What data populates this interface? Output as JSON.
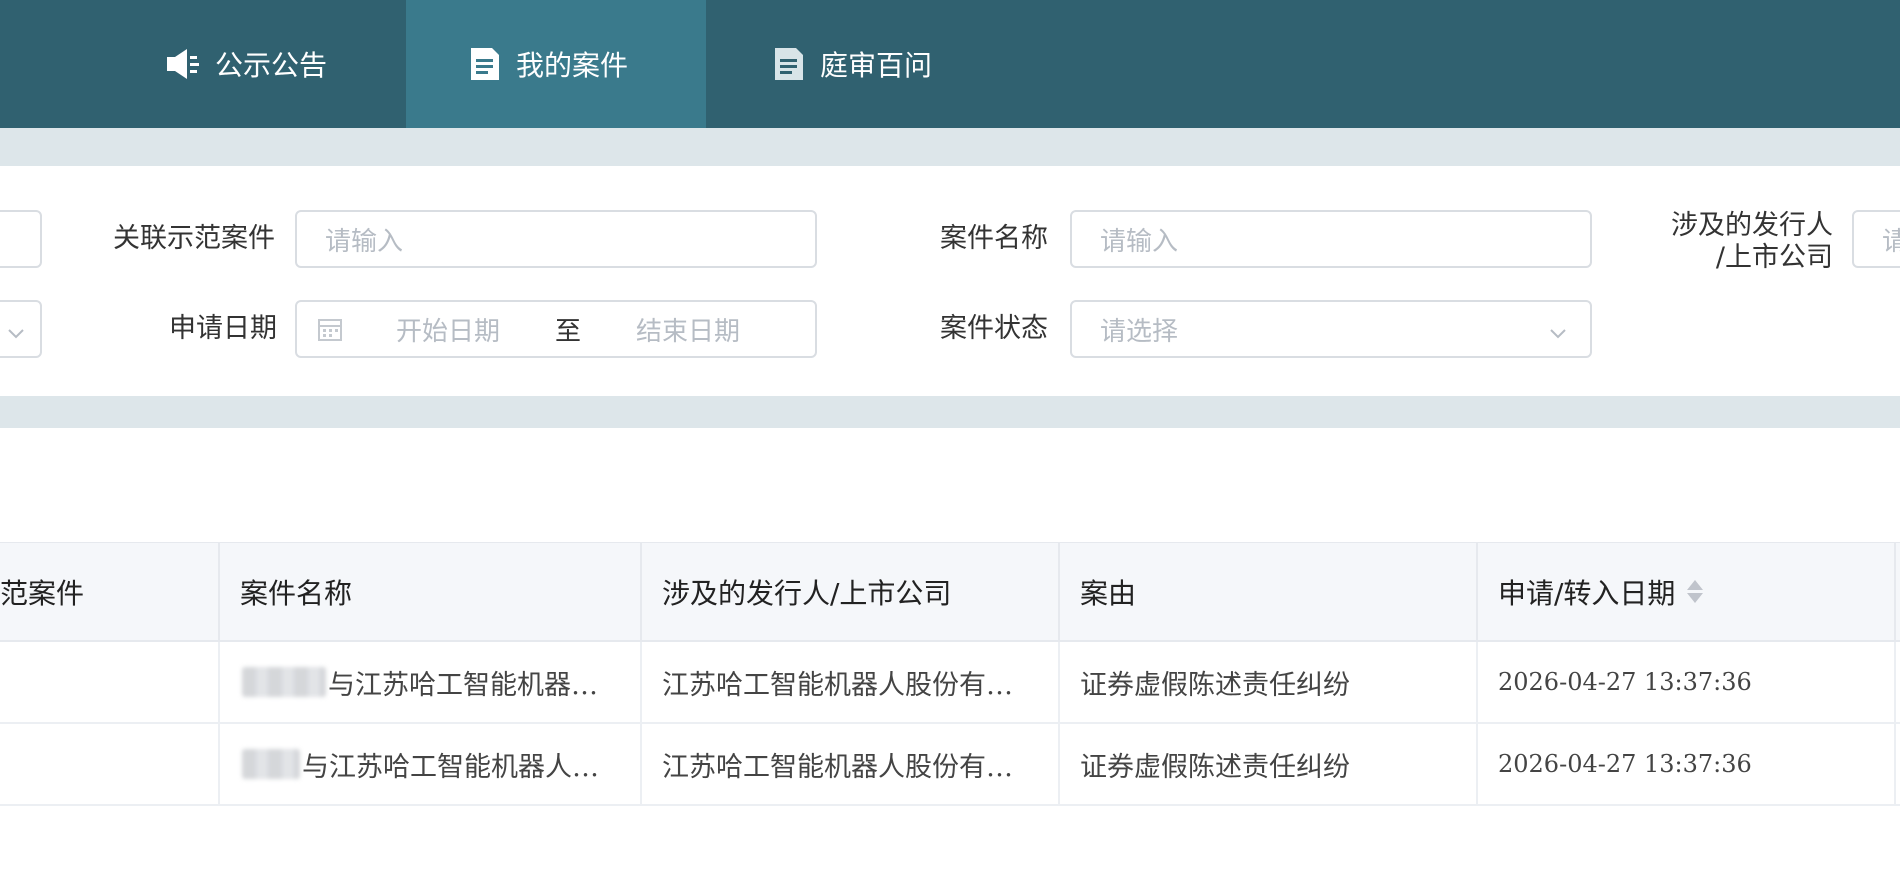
{
  "nav": {
    "items": [
      {
        "label": "公示公告",
        "icon": "speaker-icon",
        "active": false
      },
      {
        "label": "我的案件",
        "icon": "document-icon",
        "active": true
      },
      {
        "label": "庭审百问",
        "icon": "document-icon",
        "active": false
      }
    ]
  },
  "filters": {
    "related_case_label": "关联示范案件",
    "related_case_placeholder": "请输入",
    "case_name_label": "案件名称",
    "case_name_placeholder": "请输入",
    "issuer_label_line1": "涉及的发行人",
    "issuer_label_line2": "/上市公司",
    "issuer_placeholder": "请",
    "apply_date_label": "申请日期",
    "start_date_placeholder": "开始日期",
    "date_separator": "至",
    "end_date_placeholder": "结束日期",
    "case_status_label": "案件状态",
    "case_status_placeholder": "请选择"
  },
  "table": {
    "headers": {
      "related_case": "范案件",
      "case_name": "案件名称",
      "issuer": "涉及的发行人/上市公司",
      "cause": "案由",
      "apply_date": "申请/转入日期"
    },
    "rows": [
      {
        "case_name": "与江苏哈工智能机器…",
        "issuer": "江苏哈工智能机器人股份有…",
        "cause": "证券虚假陈述责任纠纷",
        "apply_date": "2026-04-27 13:37:36"
      },
      {
        "case_name": "与江苏哈工智能机器人…",
        "issuer": "江苏哈工智能机器人股份有…",
        "cause": "证券虚假陈述责任纠纷",
        "apply_date": "2026-04-27 13:37:36"
      }
    ]
  },
  "colors": {
    "nav_bg": "#306170",
    "nav_active": "#3a7a8c",
    "band": "#dde6ea"
  }
}
